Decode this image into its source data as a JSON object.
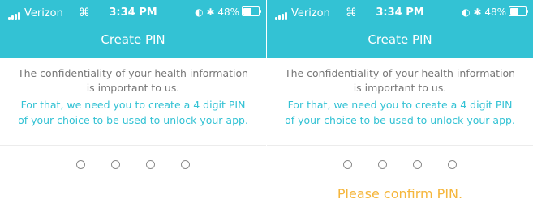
{
  "status_bar": {
    "carrier": "Verizon",
    "time": "3:34 PM",
    "battery": "48%"
  },
  "header": {
    "title": "Create PIN"
  },
  "content": {
    "confidentiality_text": "The confidentiality of your health information is important to us.",
    "instruction_text": "For that, we need you to create a 4 digit PIN of your choice to be used to unlock your app."
  },
  "pin": {
    "digits": 4
  },
  "right_screen": {
    "confirm_prompt": "Please confirm PIN."
  },
  "colors": {
    "accent": "#33c2d4",
    "prompt": "#f5b63c",
    "body_text": "#777777"
  }
}
